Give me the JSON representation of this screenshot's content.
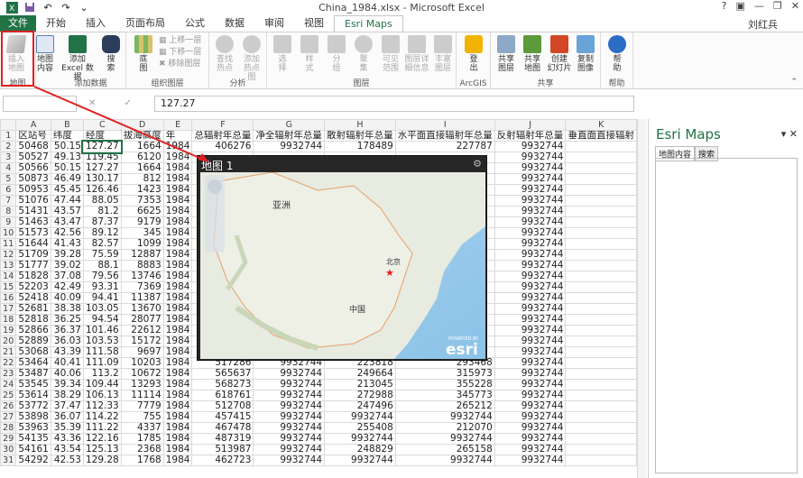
{
  "window": {
    "title": "China_1984.xlsx - Microsoft Excel",
    "user": "刘红兵"
  },
  "ribbon_tabs": [
    "文件",
    "开始",
    "插入",
    "页面布局",
    "公式",
    "数据",
    "审阅",
    "视图",
    "Esri Maps"
  ],
  "ribbon": {
    "insert_map": "插入\n地图",
    "map_content": "地图\n内容",
    "add_excel": "添加\nExcel 数据",
    "search": "搜\n索",
    "base_map": "底\n图",
    "move_up": "上移一层",
    "move_down": "下移一层",
    "remove_layer": "移除图层",
    "find_hotspot": "查找\n热点",
    "add_hotspot": "添加\n热点图",
    "select": "选\n择",
    "style": "样\n式",
    "group_btn": "分\n组",
    "cluster": "聚\n集",
    "visible_range": "可见\n范围",
    "layer_detail": "图层详\n细信息",
    "rich_layer": "丰富\n图层",
    "signout": "登\n出",
    "share_layer": "共享\n图层",
    "share_map": "共享\n地图",
    "create_slides": "创建\n幻灯片",
    "copy_image": "复制\n图像",
    "help": "帮\n助",
    "groups": {
      "map": "地图",
      "add_data": "添加数据",
      "org_layers": "组织图层",
      "analysis": "分析",
      "layers": "图层",
      "arcgis": "ArcGIS",
      "share": "共享",
      "help": "帮助"
    }
  },
  "formula_bar": {
    "fx_symbols": "✕ ✓ fx",
    "value": "127.27"
  },
  "columns": [
    "A",
    "B",
    "C",
    "D",
    "E",
    "F",
    "G",
    "H",
    "I",
    "J",
    "K"
  ],
  "headers": [
    "区站号",
    "纬度",
    "经度",
    "拔海高度",
    "年",
    "总辐射年总量",
    "净全辐射年总量",
    "散射辐射年总量",
    "水平面直接辐射年总量",
    "反射辐射年总量",
    "垂直面直接辐射"
  ],
  "rows": [
    [
      "50468",
      "50.15",
      "127.27",
      "1664",
      "1984",
      "406276",
      "9932744",
      "178489",
      "227787",
      "9932744"
    ],
    [
      "50527",
      "49.13",
      "119.45",
      "6120",
      "1984",
      "",
      "",
      "",
      "",
      "9932744"
    ],
    [
      "50566",
      "50.15",
      "127.27",
      "1664",
      "1984",
      "",
      "",
      "",
      "",
      "9932744"
    ],
    [
      "50873",
      "46.49",
      "130.17",
      "812",
      "1984",
      "",
      "",
      "",
      "",
      "9932744"
    ],
    [
      "50953",
      "45.45",
      "126.46",
      "1423",
      "1984",
      "",
      "",
      "",
      "",
      "9932744"
    ],
    [
      "51076",
      "47.44",
      "88.05",
      "7353",
      "1984",
      "",
      "",
      "",
      "",
      "9932744"
    ],
    [
      "51431",
      "43.57",
      "81.2",
      "6625",
      "1984",
      "",
      "",
      "",
      "",
      "9932744"
    ],
    [
      "51463",
      "43.47",
      "87.37",
      "9179",
      "1984",
      "",
      "",
      "",
      "",
      "9932744"
    ],
    [
      "51573",
      "42.56",
      "89.12",
      "345",
      "1984",
      "",
      "",
      "",
      "",
      "9932744"
    ],
    [
      "51644",
      "41.43",
      "82.57",
      "1099",
      "1984",
      "",
      "",
      "",
      "",
      "9932744"
    ],
    [
      "51709",
      "39.28",
      "75.59",
      "12887",
      "1984",
      "",
      "",
      "",
      "",
      "9932744"
    ],
    [
      "51777",
      "39.02",
      "88.1",
      "8883",
      "1984",
      "",
      "",
      "",
      "",
      "9932744"
    ],
    [
      "51828",
      "37.08",
      "79.56",
      "13746",
      "1984",
      "",
      "",
      "",
      "",
      "9932744"
    ],
    [
      "52203",
      "42.49",
      "93.31",
      "7369",
      "1984",
      "",
      "",
      "",
      "",
      "9932744"
    ],
    [
      "52418",
      "40.09",
      "94.41",
      "11387",
      "1984",
      "",
      "",
      "",
      "",
      "9932744"
    ],
    [
      "52681",
      "38.38",
      "103.05",
      "13670",
      "1984",
      "",
      "",
      "",
      "",
      "9932744"
    ],
    [
      "52818",
      "36.25",
      "94.54",
      "28077",
      "1984",
      "",
      "",
      "",
      "",
      "9932744"
    ],
    [
      "52866",
      "36.37",
      "101.46",
      "22612",
      "1984",
      "",
      "",
      "",
      "",
      "9932744"
    ],
    [
      "52889",
      "36.03",
      "103.53",
      "15172",
      "1984",
      "",
      "",
      "",
      "",
      "9932744"
    ],
    [
      "53068",
      "43.39",
      "111.58",
      "9697",
      "1984",
      "",
      "",
      "",
      "",
      "9932744"
    ],
    [
      "53464",
      "40.41",
      "111.09",
      "10203",
      "1984",
      "517286",
      "9932744",
      "223818",
      "293468",
      "9932744"
    ],
    [
      "53487",
      "40.06",
      "113.2",
      "10672",
      "1984",
      "565637",
      "9932744",
      "249664",
      "315973",
      "9932744"
    ],
    [
      "53545",
      "39.34",
      "109.44",
      "13293",
      "1984",
      "568273",
      "9932744",
      "213045",
      "355228",
      "9932744"
    ],
    [
      "53614",
      "38.29",
      "106.13",
      "11114",
      "1984",
      "618761",
      "9932744",
      "272988",
      "345773",
      "9932744"
    ],
    [
      "53772",
      "37.47",
      "112.33",
      "7779",
      "1984",
      "512708",
      "9932744",
      "247496",
      "265212",
      "9932744"
    ],
    [
      "53898",
      "36.07",
      "114.22",
      "755",
      "1984",
      "457415",
      "9932744",
      "9932744",
      "9932744",
      "9932744"
    ],
    [
      "53963",
      "35.39",
      "111.22",
      "4337",
      "1984",
      "467478",
      "9932744",
      "255408",
      "212070",
      "9932744"
    ],
    [
      "54135",
      "43.36",
      "122.16",
      "1785",
      "1984",
      "487319",
      "9932744",
      "9932744",
      "9932744",
      "9932744"
    ],
    [
      "54161",
      "43.54",
      "125.13",
      "2368",
      "1984",
      "513987",
      "9932744",
      "248829",
      "265158",
      "9932744"
    ],
    [
      "54292",
      "42.53",
      "129.28",
      "1768",
      "1984",
      "462723",
      "9932744",
      "9932744",
      "9932744",
      "9932744"
    ]
  ],
  "esri_pane": {
    "title": "Esri Maps",
    "tab_content": "地图内容",
    "tab_search": "搜索",
    "controls": "▾ ✕"
  },
  "map_window": {
    "title": "地图 1",
    "label_asia": "亚洲",
    "label_beijing": "北京",
    "label_china": "中国",
    "logo_small": "POWERED BY",
    "logo": "esri"
  },
  "colors": {
    "excel_green": "#217346",
    "highlight_red": "#e02020",
    "esri_blue": "#0079c1"
  }
}
